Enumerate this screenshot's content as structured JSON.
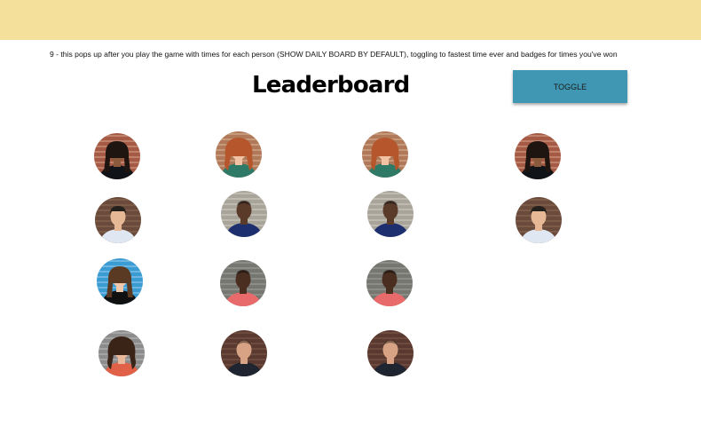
{
  "header": {
    "background": "#f4e09a"
  },
  "note": "9 - this pops up after you play the game with times for each person (SHOW DAILY BOARD BY DEFAULT), toggling to fastest time ever and badges for times you've won",
  "leaderboard": {
    "title": "Leaderboard",
    "toggle_label": "TOGGLE",
    "toggle_color": "#3f97b3"
  },
  "people": {
    "p1": {
      "bg": "#a55a45",
      "stripes": "#d9a88f",
      "skin": "#8a5a3c",
      "hair": "#1e1410",
      "shirt": "#101418",
      "hairStyle": "long"
    },
    "p2": {
      "bg": "#b07a5a",
      "stripes": "#d9b79a",
      "skin": "#f1c3a4",
      "hair": "#b5562c",
      "shirt": "#2e7a66",
      "hairStyle": "curly"
    },
    "p3": {
      "bg": "#6a4a3a",
      "stripes": "#8e6b55",
      "skin": "#e7b895",
      "hair": "#24201c",
      "shirt": "#dfe8f2",
      "hairStyle": "short"
    },
    "p4": {
      "bg": "#a9a49a",
      "stripes": "#d4d0c6",
      "skin": "#5a3a28",
      "hair": "#151010",
      "shirt": "#1d2f6e",
      "hairStyle": "bald"
    },
    "p5": {
      "bg": "#3b9bd3",
      "stripes": "#9fd2ef",
      "skin": "#f0c9ad",
      "hair": "#5a3a22",
      "shirt": "#101010",
      "hairStyle": "long"
    },
    "p6": {
      "bg": "#777772",
      "stripes": "#a3a39e",
      "skin": "#4a2e20",
      "hair": "#120c0a",
      "shirt": "#e86a6a",
      "hairStyle": "bald"
    },
    "p7": {
      "bg": "#8c8c8c",
      "stripes": "#bdbdbd",
      "skin": "#eab89a",
      "hair": "#3a2418",
      "shirt": "#e06048",
      "hairStyle": "curly"
    },
    "p8": {
      "bg": "#5a3a30",
      "stripes": "#7e5a4a",
      "skin": "#d7a384",
      "hair": "#3a2a22",
      "shirt": "#1e2430",
      "hairStyle": "bald"
    }
  },
  "avatars": [
    {
      "name": "avatar-r1c1",
      "person": "p1"
    },
    {
      "name": "avatar-r1c2",
      "person": "p2"
    },
    {
      "name": "avatar-r1c3",
      "person": "p2"
    },
    {
      "name": "avatar-r1c4",
      "person": "p1"
    },
    {
      "name": "avatar-r2c1",
      "person": "p3"
    },
    {
      "name": "avatar-r2c2",
      "person": "p4"
    },
    {
      "name": "avatar-r2c3",
      "person": "p4"
    },
    {
      "name": "avatar-r2c4",
      "person": "p3"
    },
    {
      "name": "avatar-r3c1",
      "person": "p5"
    },
    {
      "name": "avatar-r3c2",
      "person": "p6"
    },
    {
      "name": "avatar-r3c3",
      "person": "p6"
    },
    {
      "name": "avatar-r4c1",
      "person": "p7"
    },
    {
      "name": "avatar-r4c2",
      "person": "p8"
    },
    {
      "name": "avatar-r4c3",
      "person": "p8"
    }
  ]
}
